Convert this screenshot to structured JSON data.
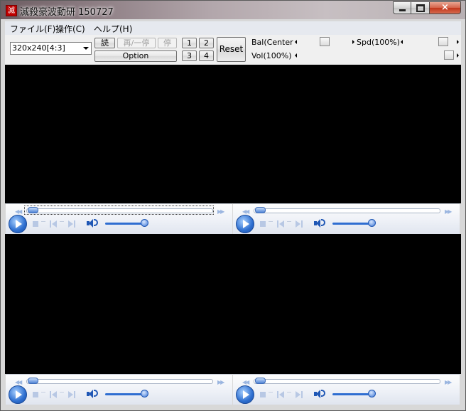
{
  "window": {
    "title": "滅殺豪波動研 150727",
    "icon_glyph": "滅",
    "caption": {
      "minimize": "minimize-icon",
      "maximize": "maximize-icon",
      "close": "×"
    }
  },
  "menu": [
    "ファイル(F)",
    "操作(C)",
    "ヘルプ(H)"
  ],
  "toolbar": {
    "resolution_value": "320x240[4:3]",
    "load_label": "読",
    "play_pause_label": "再/一停",
    "stop_label": "停",
    "option_label": "Option",
    "screen_buttons": [
      "1",
      "2",
      "3",
      "4"
    ],
    "reset_label": "Reset",
    "balance_label": "Bal(Center)",
    "speed_label": "Spd(100%)",
    "volume_label": "Vol(100%)",
    "balance_level": 0.5,
    "speed_level": 0.85,
    "volume_level": 1.0
  },
  "players": [
    {
      "id": 1,
      "seek_position": 0.0,
      "volume_level": 0.85,
      "focused": true
    },
    {
      "id": 2,
      "seek_position": 0.0,
      "volume_level": 0.85,
      "focused": false
    },
    {
      "id": 3,
      "seek_position": 0.0,
      "volume_level": 0.85,
      "focused": false
    },
    {
      "id": 4,
      "seek_position": 0.0,
      "volume_level": 0.85,
      "focused": false
    }
  ],
  "colors": {
    "video_background": "#000000",
    "player_accent": "#2e6fd0",
    "close_button": "#c2361b"
  }
}
